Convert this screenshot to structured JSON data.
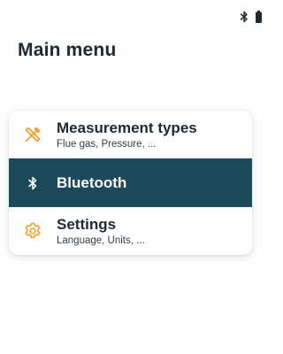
{
  "status_bar": {
    "bluetooth_icon": "bluetooth-icon",
    "battery_icon": "battery-icon"
  },
  "page_title": "Main menu",
  "menu": {
    "items": [
      {
        "label": "Measurement types",
        "sublabel": "Flue gas, Pressure, ...",
        "icon": "measurement-tools-icon",
        "icon_color": "#f0a22e",
        "selected": false
      },
      {
        "label": "Bluetooth",
        "sublabel": "",
        "icon": "bluetooth-icon",
        "icon_color": "#ffffff",
        "selected": true
      },
      {
        "label": "Settings",
        "sublabel": "Language, Units, ...",
        "icon": "gear-icon",
        "icon_color": "#f0a22e",
        "selected": false
      }
    ]
  },
  "colors": {
    "selected_background": "#1d4a5b",
    "accent": "#f0a22e",
    "text": "#1e2a33"
  }
}
